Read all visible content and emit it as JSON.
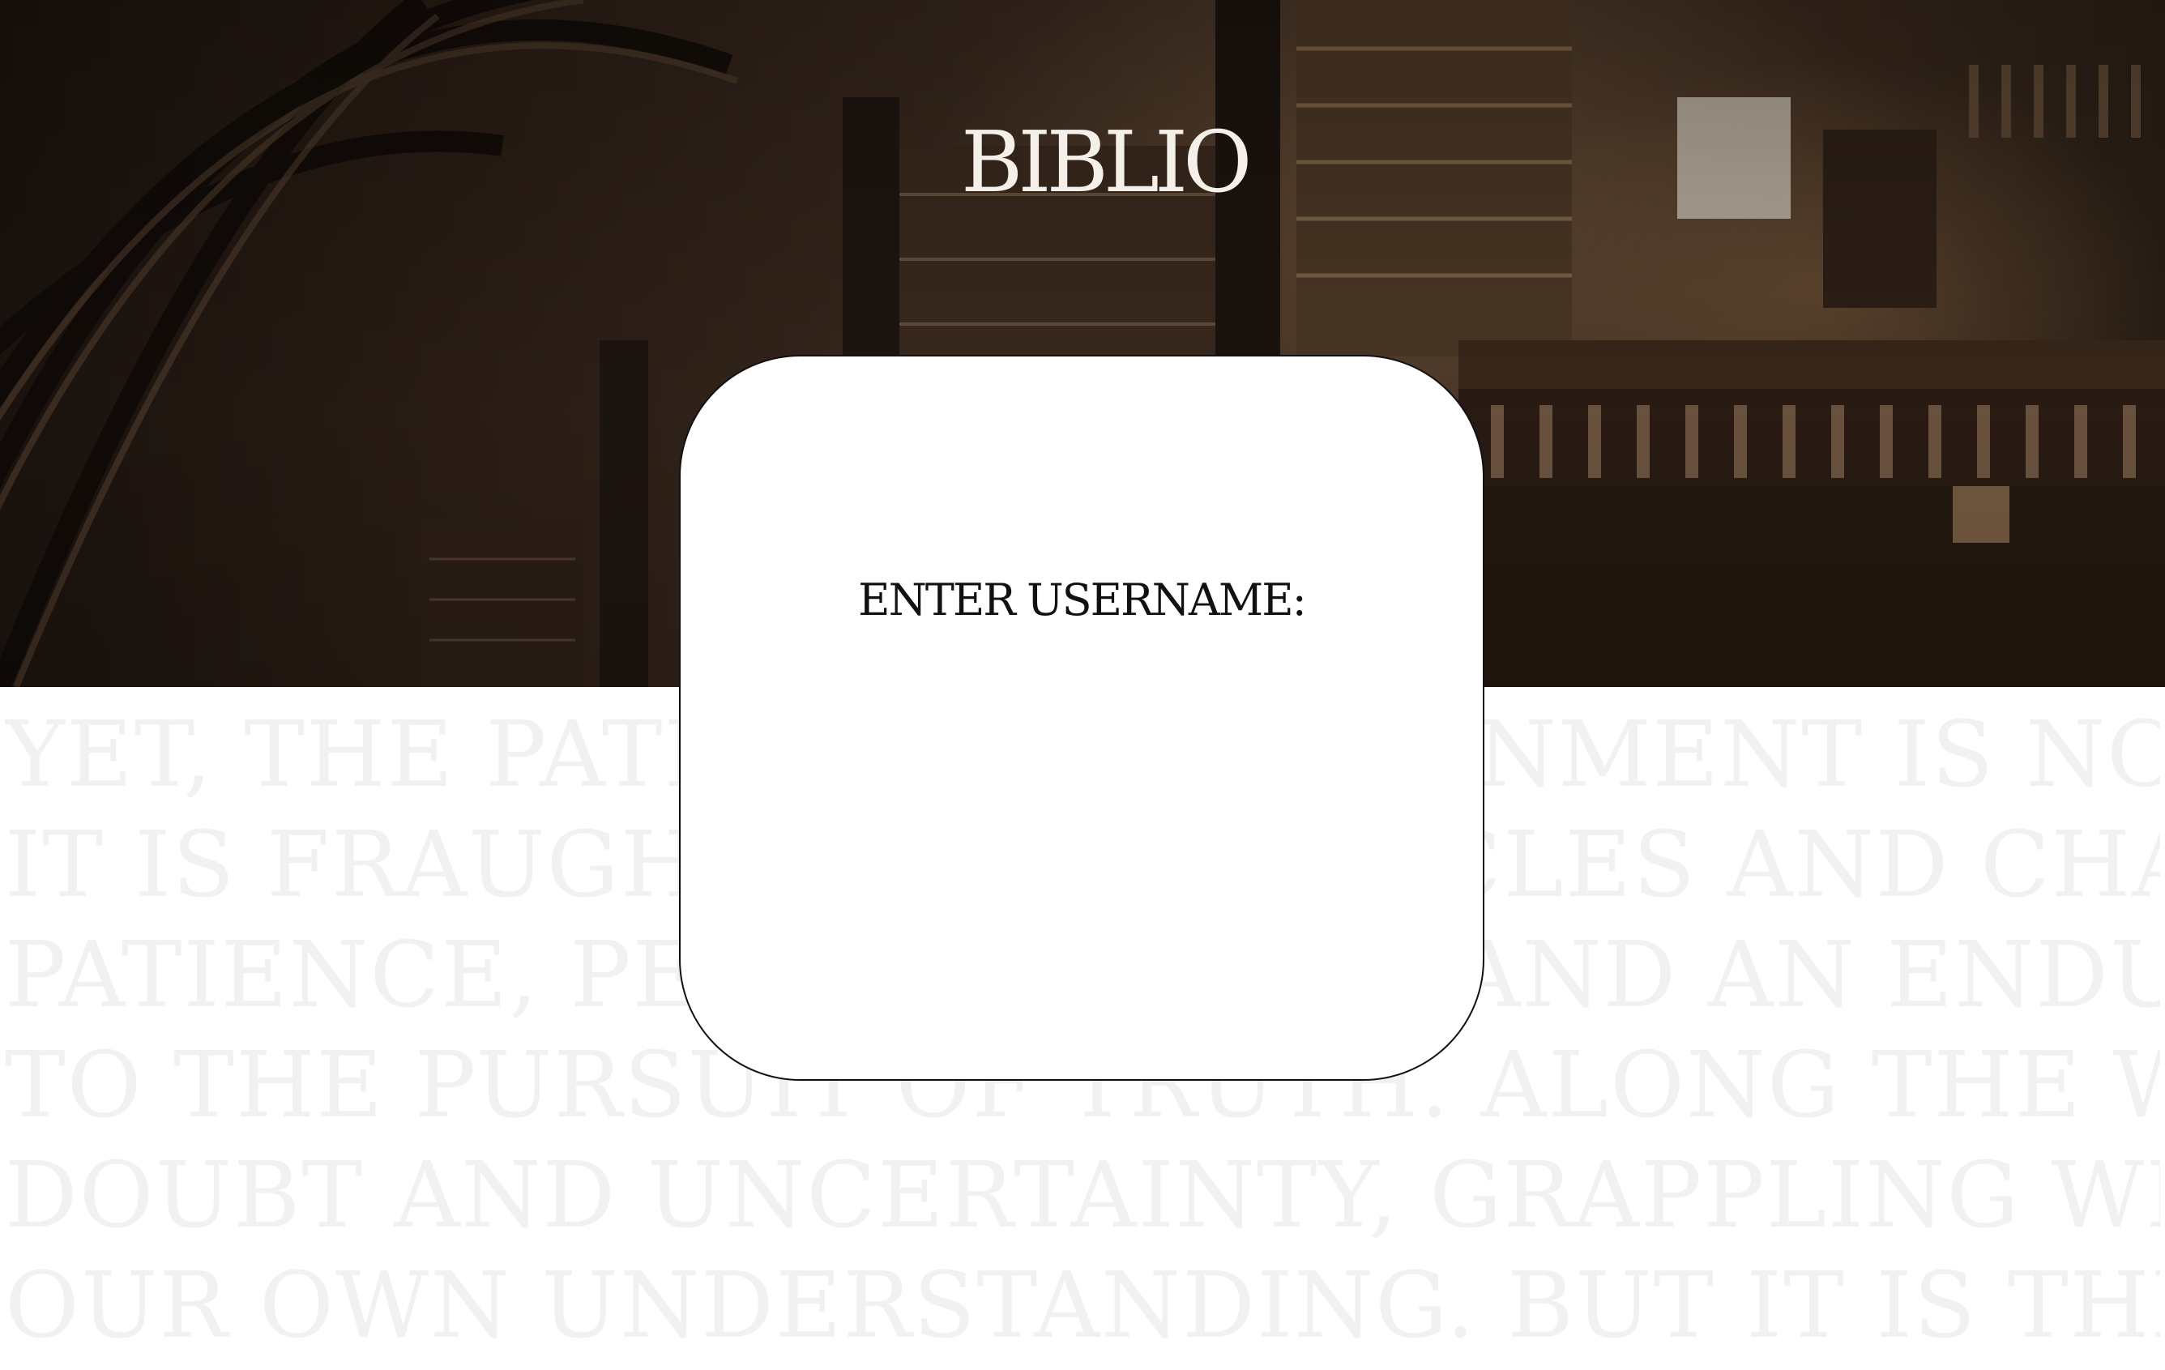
{
  "app": {
    "logo_text": "BIBLIO"
  },
  "background_text": {
    "lines": [
      "YET, THE PATH TO ENLIGHTENMENT IS NOT ALWAYS CLEAR-CUT.",
      "IT IS FRAUGHT WITH OBSTACLES AND CHALLENGES, REQUIRING",
      "PATIENCE, PERSEVERANCE, AND AN ENDURING COMMITMENT",
      "TO THE PURSUIT OF TRUTH. ALONG THE WAY, WE ENCOUNTER",
      "DOUBT AND UNCERTAINTY, GRAPPLING WITH THE LIMITATIONS OF",
      "OUR OWN UNDERSTANDING. BUT IT IS THROUGH THESE"
    ]
  },
  "login_card": {
    "prompt_label": "ENTER USERNAME:",
    "username_value": ""
  },
  "colors": {
    "card_border": "#111111",
    "background_text": "#f1f1f1",
    "logo": "#f4efe8"
  }
}
